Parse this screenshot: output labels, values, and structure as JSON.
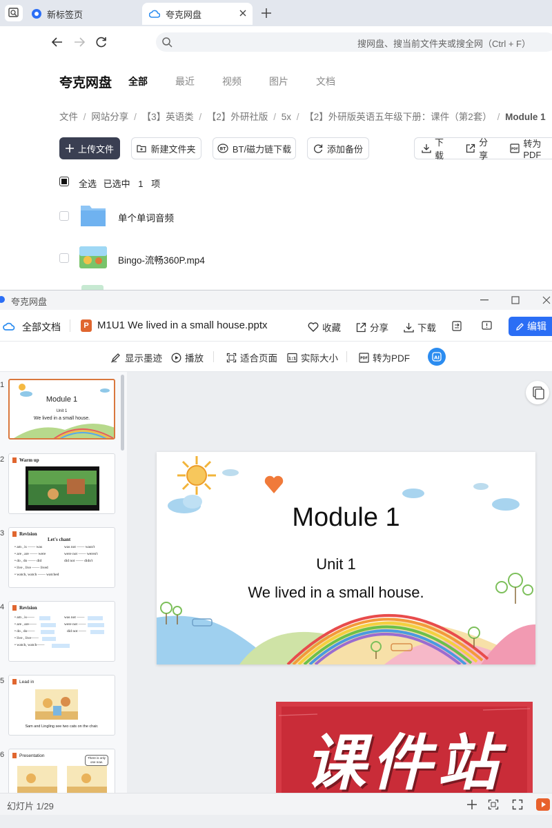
{
  "browser": {
    "tabs": [
      {
        "label": "新标签页"
      },
      {
        "label": "夸克网盘"
      }
    ],
    "search_placeholder": "搜网盘、搜当前文件夹或搜全网（Ctrl + F）"
  },
  "drive": {
    "logo": "夸克网盘",
    "nav_tabs": [
      "全部",
      "最近",
      "视频",
      "图片",
      "文档"
    ],
    "breadcrumb": [
      "文件",
      "/",
      "网站分享",
      "/",
      "【3】英语类",
      "/",
      "【2】外研社版",
      "/",
      "5x",
      "/",
      "【2】外研版英语五年级下册：课件（第2套）",
      "/",
      "Module 1"
    ],
    "buttons": {
      "upload": "上传文件",
      "new_folder": "新建文件夹",
      "bt": "BT/磁力链下载",
      "backup": "添加备份",
      "download": "下载",
      "share": "分享",
      "to_pdf": "转为PDF"
    },
    "select_all": "全选",
    "selected_prefix": "已选中",
    "selected_count": "1",
    "selected_suffix": "项",
    "files": [
      {
        "name": "单个单词音频",
        "type": "folder"
      },
      {
        "name": "Bingo-流畅360P.mp4",
        "type": "video"
      }
    ]
  },
  "viewer": {
    "window_title": "夸克网盘",
    "all_docs": "全部文档",
    "file_name": "M1U1 We lived in a small house.pptx",
    "actions": {
      "favorite": "收藏",
      "share": "分享",
      "download": "下载",
      "edit": "编辑"
    },
    "toolbar": {
      "show_ink": "显示墨迹",
      "play": "播放",
      "fit_page": "适合页面",
      "actual_size": "实际大小",
      "to_pdf": "转为PDF"
    },
    "thumbnails": [
      {
        "num": "1",
        "title": "Module 1",
        "sub1": "Unit 1",
        "sub2": "We lived in a small house."
      },
      {
        "num": "2",
        "title": "Warm up"
      },
      {
        "num": "3",
        "title": "Revision",
        "heading": "Let's chant",
        "lines": [
          "• am , is —— was",
          "• are , are —— were",
          "• do , do —— did",
          "• live , live —— lived",
          "• watch, watch —— watched"
        ],
        "right": [
          "was not —— wasn't",
          "were not —— weren't",
          "did not —— didn't"
        ]
      },
      {
        "num": "4",
        "title": "Revision",
        "lines": [
          "• am , is——",
          "• are , are——",
          "• do , do——",
          "• live , live——",
          "• watch, watch——"
        ],
        "right": [
          "was not ——",
          "were not ——",
          "did not ——"
        ]
      },
      {
        "num": "5",
        "title": "Lead in",
        "caption": "Sam and Lingling see two cats on the chair."
      },
      {
        "num": "6",
        "title": "Presentation",
        "bubble": "There is only one now."
      }
    ],
    "slide": {
      "title": "Module 1",
      "unit": "Unit 1",
      "subtitle": "We lived in a small house."
    },
    "status": "幻灯片 1/29",
    "watermark": "课件站"
  }
}
